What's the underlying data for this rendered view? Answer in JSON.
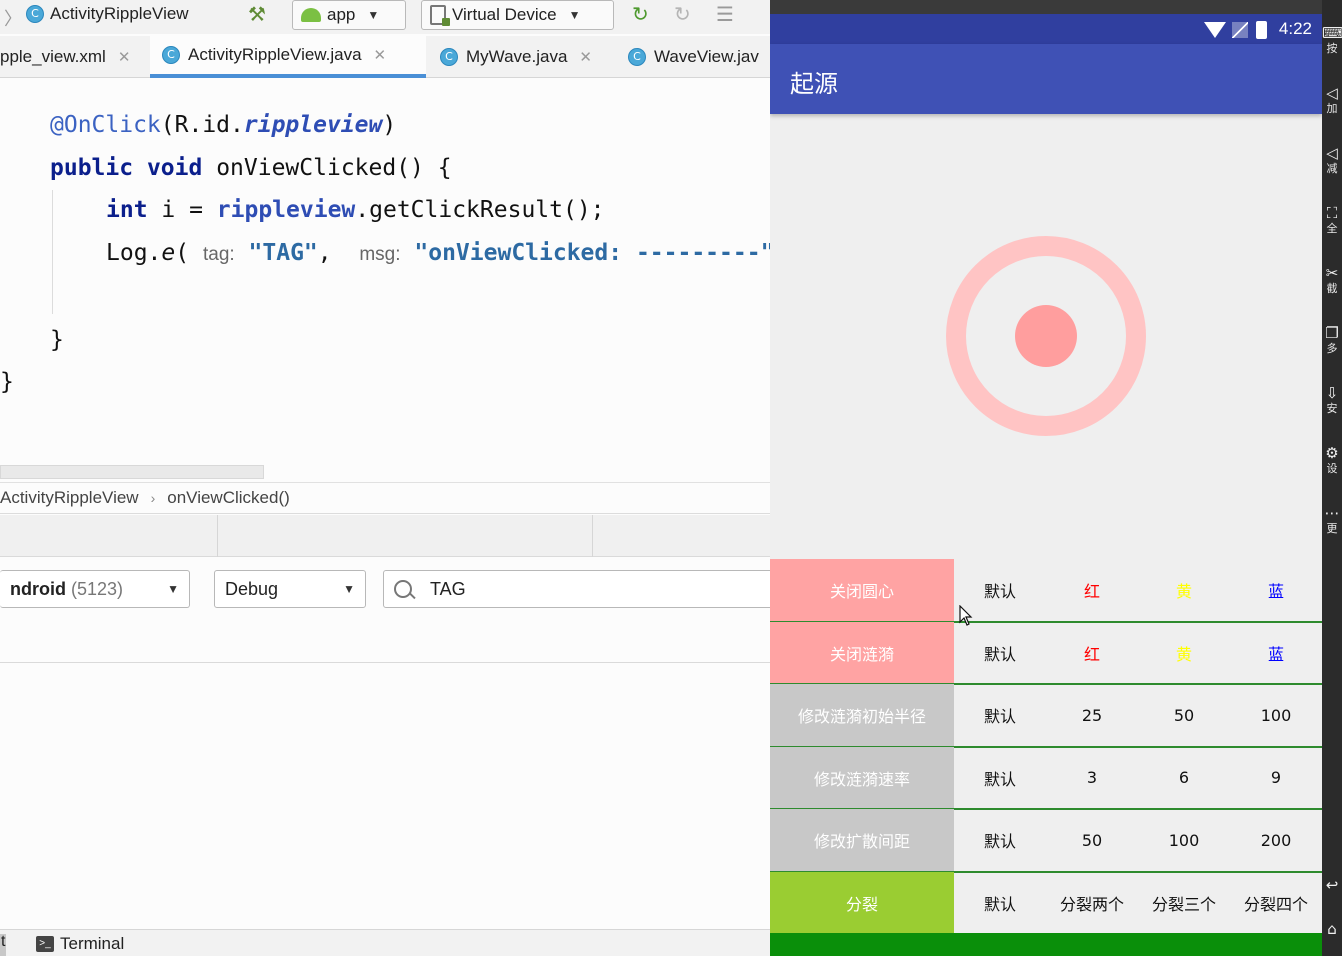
{
  "ide": {
    "toolbar": {
      "class_badge": "C",
      "file_title": "ActivityRippleView",
      "run_config": "app",
      "device": "Virtual Device"
    },
    "tabs": [
      {
        "label": "pple_view.xml",
        "close": "✕"
      },
      {
        "label": "ActivityRippleView.java",
        "close": "✕",
        "active": true
      },
      {
        "label": "MyWave.java",
        "close": "✕"
      },
      {
        "label": "WaveView.jav"
      }
    ],
    "code": {
      "l1_annotation": "@OnClick",
      "l1_open": "(R.id.",
      "l1_field": "rippleview",
      "l1_close": ")",
      "l2_kw1": "public",
      "l2_kw2": "void",
      "l2_rest": " onViewClicked() {",
      "l3_kw": "int",
      "l3_mid": " i = ",
      "l3_field": "rippleview",
      "l3_rest": ".getClickResult();",
      "l4_log": "Log.",
      "l4_method": "e",
      "l4_paren": "(",
      "l4_hint_tag": "tag:",
      "l4_str_tag": "\"TAG\"",
      "l4_comma": ",",
      "l4_hint_msg": "msg:",
      "l4_str_msg": "\"onViewClicked: ---------\"",
      "l6_brace": "}",
      "l7_brace": "}"
    },
    "breadcrumb": {
      "class": "ActivityRippleView",
      "sep": "›",
      "method": "onViewClicked()"
    },
    "logcat": {
      "process": "ndroid",
      "process_count": "(5123)",
      "level": "Debug",
      "search_value": "TAG"
    },
    "bottom": {
      "left_edge": "t",
      "terminal": "Terminal",
      "terminal_glyph": ">_"
    }
  },
  "emulator": {
    "status": {
      "time": "4:22"
    },
    "appbar_title": "起源",
    "rows": [
      {
        "label": "关闭圆心",
        "bg": "#ffa3a3",
        "cells": [
          {
            "text": "默认",
            "color": "#111111"
          },
          {
            "text": "红",
            "color": "#ff0000"
          },
          {
            "text": "黄",
            "color": "#ffff00"
          },
          {
            "text": "蓝",
            "color": "#0000ff"
          }
        ]
      },
      {
        "label": "关闭涟漪",
        "bg": "#ffa3a3",
        "cells": [
          {
            "text": "默认",
            "color": "#111111"
          },
          {
            "text": "红",
            "color": "#ff0000"
          },
          {
            "text": "黄",
            "color": "#ffff00"
          },
          {
            "text": "蓝",
            "color": "#0000ff"
          }
        ]
      },
      {
        "label": "修改涟漪初始半径",
        "bg": "#c8c8c8",
        "cells": [
          {
            "text": "默认",
            "color": "#111111"
          },
          {
            "text": "25",
            "color": "#111111"
          },
          {
            "text": "50",
            "color": "#111111"
          },
          {
            "text": "100",
            "color": "#111111"
          }
        ]
      },
      {
        "label": "修改涟漪速率",
        "bg": "#c8c8c8",
        "cells": [
          {
            "text": "默认",
            "color": "#111111"
          },
          {
            "text": "3",
            "color": "#111111"
          },
          {
            "text": "6",
            "color": "#111111"
          },
          {
            "text": "9",
            "color": "#111111"
          }
        ]
      },
      {
        "label": "修改扩散间距",
        "bg": "#c8c8c8",
        "cells": [
          {
            "text": "默认",
            "color": "#111111"
          },
          {
            "text": "50",
            "color": "#111111"
          },
          {
            "text": "100",
            "color": "#111111"
          },
          {
            "text": "200",
            "color": "#111111"
          }
        ]
      },
      {
        "label": "分裂",
        "bg": "#9acd32",
        "cells": [
          {
            "text": "默认",
            "color": "#111111"
          },
          {
            "text": "分裂两个",
            "color": "#111111"
          },
          {
            "text": "分裂三个",
            "color": "#111111"
          },
          {
            "text": "分裂四个",
            "color": "#111111"
          }
        ]
      }
    ]
  },
  "side_toolbar": [
    {
      "icon": "keyboard-icon",
      "label": "按"
    },
    {
      "icon": "volume-up-icon",
      "label": "加"
    },
    {
      "icon": "volume-down-icon",
      "label": "减"
    },
    {
      "icon": "fullscreen-icon",
      "label": "全"
    },
    {
      "icon": "screenshot-icon",
      "label": "截"
    },
    {
      "icon": "multi-window-icon",
      "label": "多"
    },
    {
      "icon": "install-icon",
      "label": "安"
    },
    {
      "icon": "settings-icon",
      "label": "设"
    },
    {
      "icon": "more-icon",
      "label": "更"
    }
  ],
  "colors": {
    "appbar": "#3f51b5",
    "statusbar": "#303f9f",
    "ring": "#ffc4c4",
    "center_dot": "#ff9e9e",
    "grid_divider": "#2e8b2e",
    "footer": "#0a8f0a"
  }
}
